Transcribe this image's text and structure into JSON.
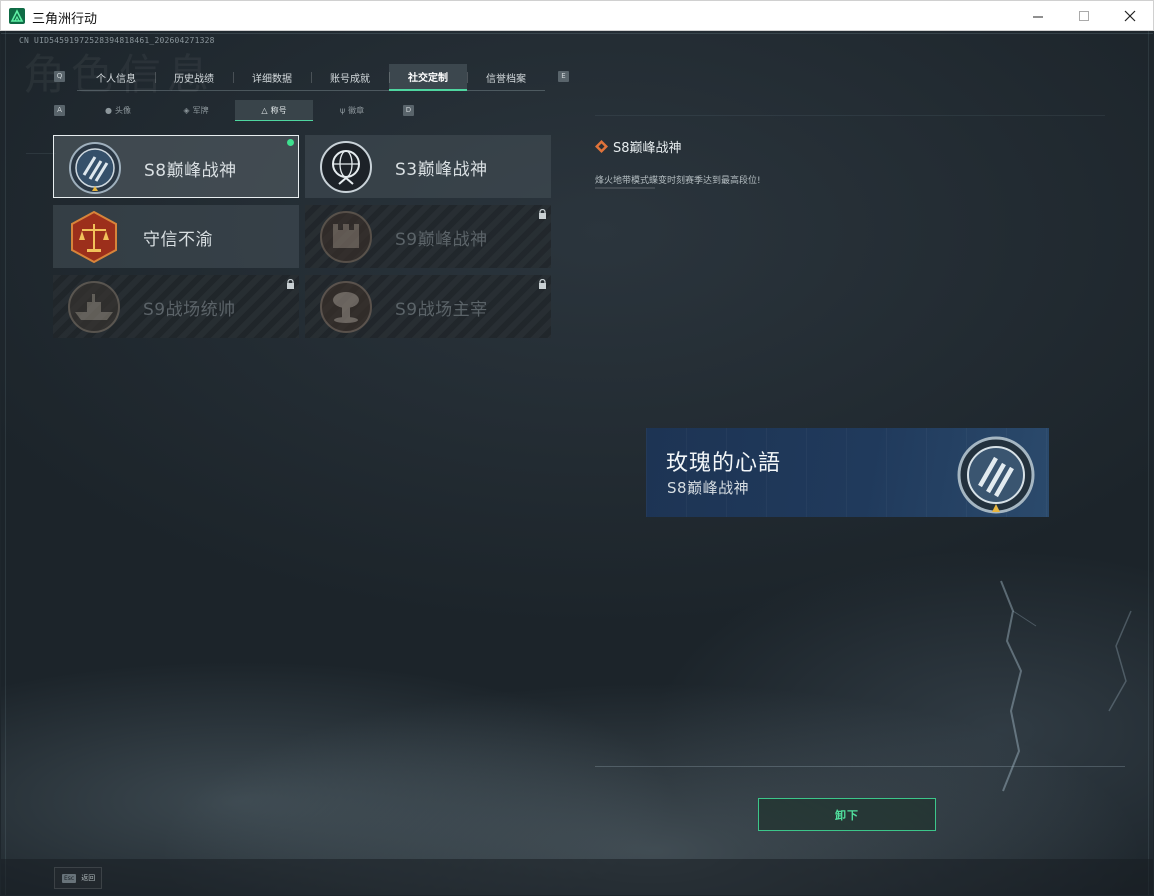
{
  "window": {
    "title": "三角洲行动",
    "min_icon": "minimize-icon",
    "max_icon": "maximize-icon",
    "close_icon": "close-icon"
  },
  "header": {
    "uid": "CN UID54591972528394818461_202604271328",
    "watermark": "角色信息"
  },
  "key_hints": {
    "tab_prev": "Q",
    "tab_next": "E",
    "sub_prev": "A",
    "sub_next": "D"
  },
  "tabs": [
    {
      "label": "个人信息"
    },
    {
      "label": "历史战绩"
    },
    {
      "label": "详细数据"
    },
    {
      "label": "账号成就"
    },
    {
      "label": "社交定制",
      "active": true
    },
    {
      "label": "信誉档案"
    }
  ],
  "subtabs": [
    {
      "label": "头像",
      "icon": "person-icon"
    },
    {
      "label": "军牌",
      "icon": "dogtag-icon"
    },
    {
      "label": "称号",
      "icon": "emblem-icon",
      "active": true
    },
    {
      "label": "徽章",
      "icon": "wing-icon"
    }
  ],
  "titles": [
    {
      "name": "S8巅峰战神",
      "badge": "stripes-medal-icon",
      "selected": true,
      "equipped": true,
      "locked": false
    },
    {
      "name": "S3巅峰战神",
      "badge": "globe-medal-icon",
      "selected": false,
      "equipped": false,
      "locked": false
    },
    {
      "name": "守信不渝",
      "badge": "scales-medal-icon",
      "selected": false,
      "equipped": false,
      "locked": false
    },
    {
      "name": "S9巅峰战神",
      "badge": "fortress-medal-icon",
      "selected": false,
      "equipped": false,
      "locked": true
    },
    {
      "name": "S9战场统帅",
      "badge": "warship-medal-icon",
      "selected": false,
      "equipped": false,
      "locked": true
    },
    {
      "name": "S9战场主宰",
      "badge": "mushroom-cloud-medal-icon",
      "selected": false,
      "equipped": false,
      "locked": true
    }
  ],
  "detail": {
    "title": "S8巅峰战神",
    "description": "烽火地带模式蝶变时刻赛季达到最高段位!"
  },
  "preview": {
    "player_name": "玫瑰的心語",
    "title": "S8巅峰战神"
  },
  "actions": {
    "unequip": "卸下"
  },
  "footer": {
    "esc_key": "Esc",
    "esc_label": "返回"
  },
  "colors": {
    "accent": "#4fd6a0",
    "equipped_dot": "#3ee08f",
    "detail_icon": "#e0733a",
    "banner": "#203a5c"
  }
}
